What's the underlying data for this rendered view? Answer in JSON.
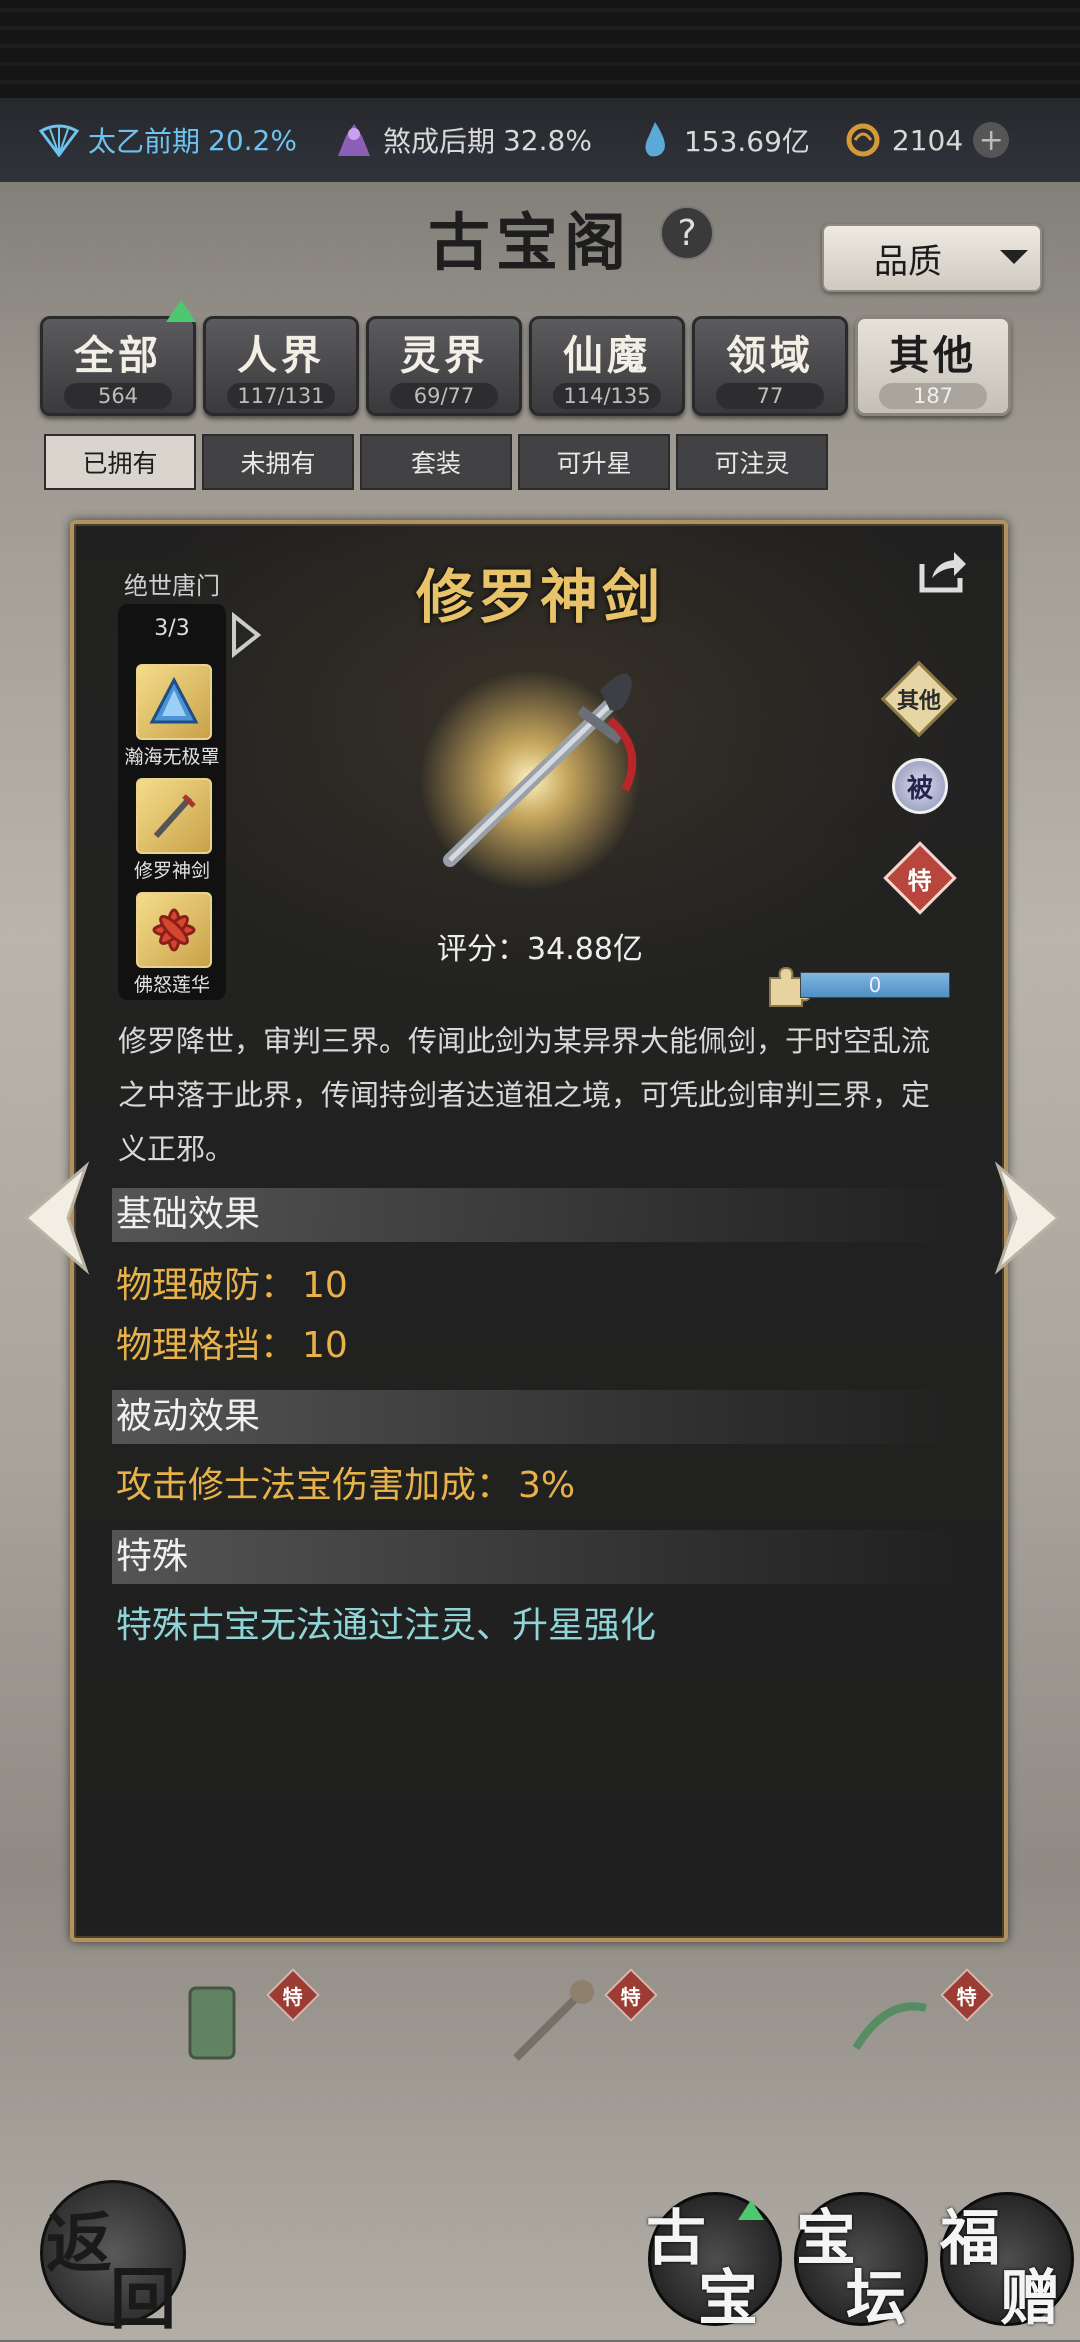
{
  "resources": {
    "realm1_label": "太乙前期",
    "realm1_pct": "20.2%",
    "realm2_label": "煞成后期",
    "realm2_pct": "32.8%",
    "spirit": "153.69亿",
    "coins": "2104",
    "plus": "+"
  },
  "header": {
    "title": "古宝阁",
    "help": "?",
    "quality_dropdown": "品质"
  },
  "categories": [
    {
      "label": "全部",
      "count": "564"
    },
    {
      "label": "人界",
      "count": "117/131"
    },
    {
      "label": "灵界",
      "count": "69/77"
    },
    {
      "label": "仙魔",
      "count": "114/135"
    },
    {
      "label": "领域",
      "count": "77"
    },
    {
      "label": "其他",
      "count": "187",
      "active": true
    }
  ],
  "filters": [
    "已拥有",
    "未拥有",
    "套装",
    "可升星",
    "可注灵"
  ],
  "item": {
    "name": "修罗神剑",
    "set_name": "绝世唐门",
    "set_progress": "3/3",
    "set_items": [
      "瀚海无极罩",
      "修罗神剑",
      "佛怒莲华"
    ],
    "score": "评分：34.88亿",
    "fragment_value": "0",
    "fragment_fraction": 1.0,
    "badges": [
      "其他",
      "被",
      "特"
    ],
    "description": "修罗降世，审判三界。传闻此剑为某异界大能佩剑，于时空乱流之中落于此界，传闻持剑者达道祖之境，可凭此剑审判三界，定义正邪。",
    "base_title": "基础效果",
    "base_stats": [
      {
        "label": "物理破防：",
        "value": "10"
      },
      {
        "label": "物理格挡：",
        "value": "10"
      }
    ],
    "passive_title": "被动效果",
    "passive_stats": [
      {
        "label": "攻击修士法宝伤害加成：",
        "value": "3%"
      }
    ],
    "special_title": "特殊",
    "special_text": "特殊古宝无法通过注灵、升星强化"
  },
  "bottom_badges": [
    "特",
    "特",
    "特"
  ],
  "nav": {
    "back": [
      "返",
      "回"
    ],
    "ancient": [
      "古",
      "宝"
    ],
    "altar": [
      "宝",
      "坛"
    ],
    "gift": [
      "福",
      "赠"
    ]
  },
  "colors": {
    "gold_title": "#e8c36a",
    "stat_orange": "#e8b24a",
    "special_cyan": "#8fd4d6",
    "accent_green": "#4dc870"
  }
}
